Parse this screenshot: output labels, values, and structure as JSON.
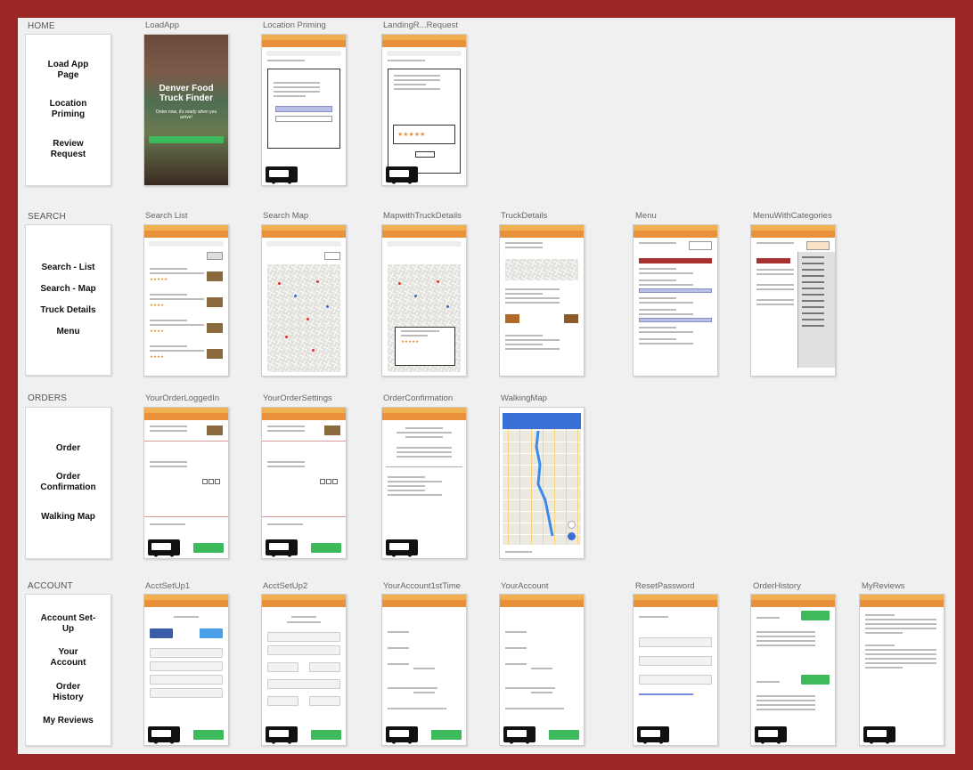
{
  "sections": [
    {
      "title": "HOME",
      "items": [
        "Load App\nPage",
        "Location\nPriming",
        "Review\nRequest"
      ],
      "screens": [
        "LoadApp",
        "Location Priming",
        "LandingR...Request"
      ]
    },
    {
      "title": "SEARCH",
      "items": [
        "Search - List",
        "Search - Map",
        "Truck Details",
        "Menu"
      ],
      "screens": [
        "Search List",
        "Search Map",
        "MapwithTruckDetails",
        "TruckDetails",
        "Menu",
        "MenuWithCategories"
      ]
    },
    {
      "title": "ORDERS",
      "items": [
        "Order",
        "Order\nConfirmation",
        "Walking Map"
      ],
      "screens": [
        "YourOrderLoggedIn",
        "YourOrderSettings",
        "OrderConfirmation",
        "WalkingMap"
      ]
    },
    {
      "title": "ACCOUNT",
      "items": [
        "Account Set-\nUp",
        "Your\nAccount",
        "Order\nHistory",
        "My Reviews"
      ],
      "screens": [
        "AcctSetUp1",
        "AcctSetUp2",
        "YourAccount1stTime",
        "YourAccount",
        "ResetPassword",
        "OrderHistory",
        "MyReviews"
      ]
    }
  ],
  "load_app": {
    "title": "Denver Food Truck Finder",
    "subtitle": "Order now, it's ready when you arrive!"
  },
  "colors": {
    "frame": "#9b2626",
    "accent": "#e8913a",
    "go": "#3dbb5c",
    "map_blue": "#3a6fd8"
  }
}
